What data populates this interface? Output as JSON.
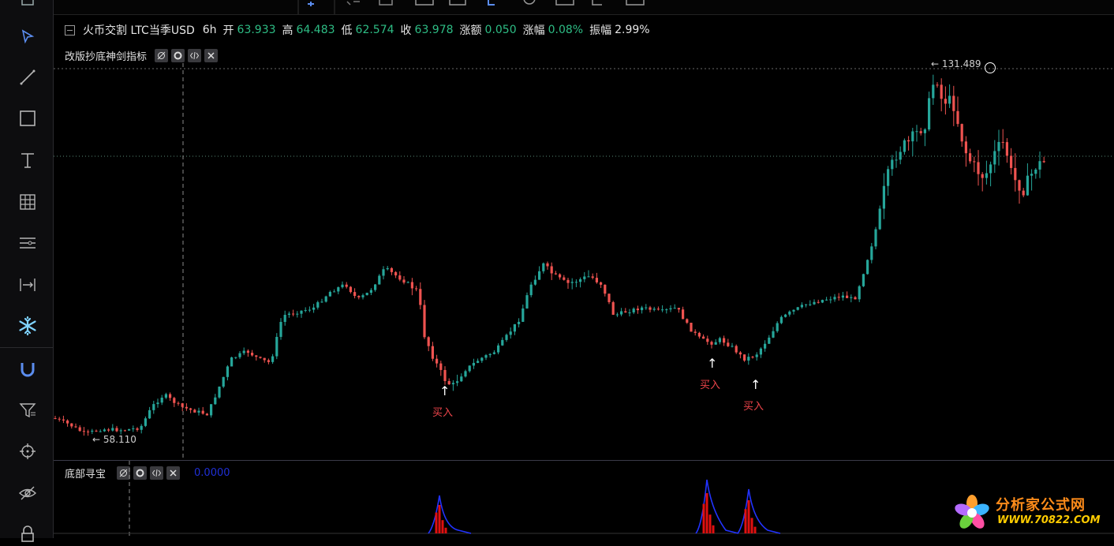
{
  "symbol": {
    "exchange_pair": "火币交割 LTC当季USD",
    "interval": "6h",
    "open_label": "开",
    "open": "63.933",
    "high_label": "高",
    "high": "64.483",
    "low_label": "低",
    "low": "62.574",
    "close_label": "收",
    "close": "63.978",
    "change_label": "涨额",
    "change": "0.050",
    "change_pct_label": "涨幅",
    "change_pct": "0.08%",
    "amplitude_label": "振幅",
    "amplitude": "2.99%"
  },
  "main_pane": {
    "indicator_name": "改版抄底神剑指标",
    "max_label": "131.489",
    "min_label": "58.110",
    "buy_signals": [
      {
        "text": "买入"
      },
      {
        "text": "买入"
      },
      {
        "text": "买入"
      }
    ]
  },
  "sub_pane": {
    "indicator_name": "底部寻宝",
    "value": "0.0000"
  },
  "colors": {
    "up": "#26a69a",
    "down": "#ef5350",
    "signal": "#f0454b",
    "curve": "#2233ff"
  },
  "sidebar_tools": [
    "cursor-icon",
    "trend-line-icon",
    "rectangle-icon",
    "text-icon",
    "grid-icon",
    "levels-icon",
    "measure-icon",
    "snowflake-icon",
    "magnet-icon",
    "filter-icon",
    "crosshair-icon",
    "eye-off-icon",
    "lock-icon"
  ],
  "watermark": {
    "brand": "分析家公式网",
    "site": "WWW.70822.COM"
  },
  "chart_data": {
    "type": "candlestick",
    "price_range": [
      58.11,
      131.489
    ],
    "interval": "6h"
  }
}
